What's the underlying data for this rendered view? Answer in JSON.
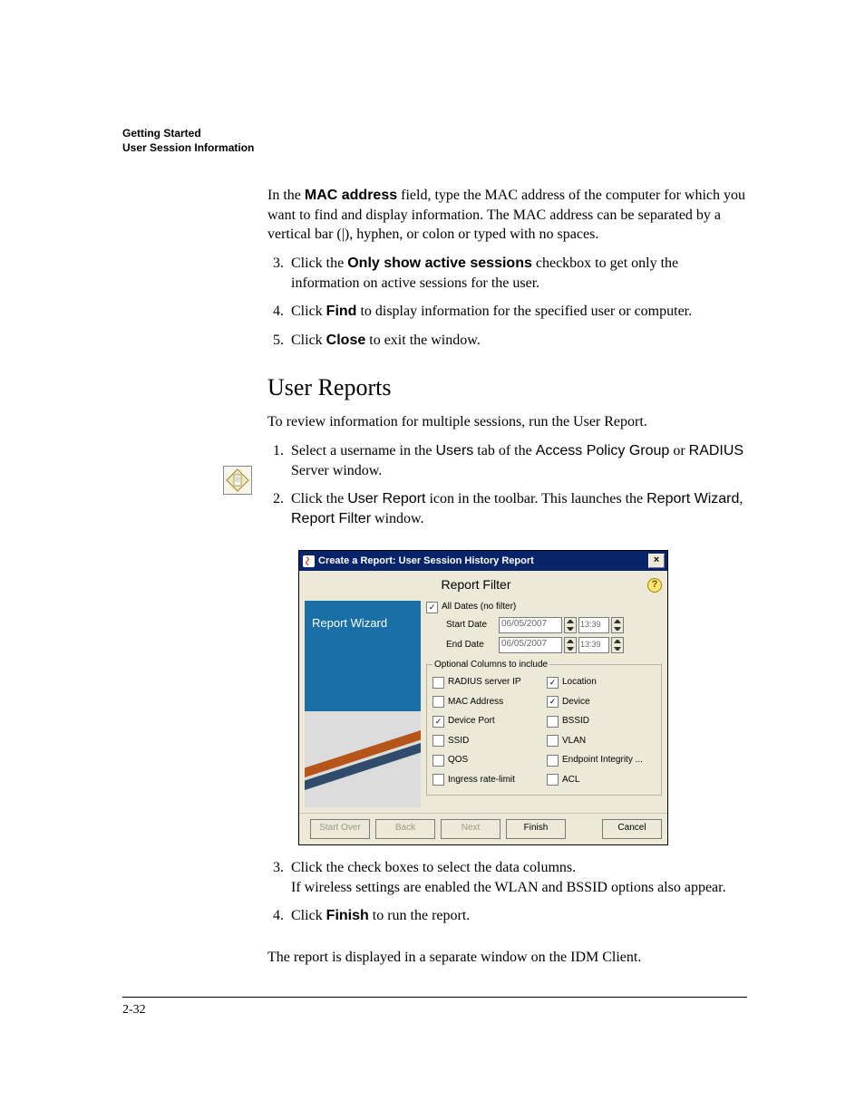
{
  "header": {
    "line1": "Getting Started",
    "line2": "User Session Information"
  },
  "intro_para": {
    "pre": "In the ",
    "bold": "MAC address",
    "post": " field, type the MAC address of the computer for which you want to find and display information. The MAC address can be separated by a vertical bar (|), hyphen, or colon or typed with no spaces."
  },
  "steps_a": {
    "s3": {
      "pre": "Click the ",
      "bold": "Only show active sessions",
      "post": " checkbox to get only the information on active sessions for the user."
    },
    "s4": {
      "pre": "Click ",
      "bold": "Find",
      "post": " to display information for the specified user or computer."
    },
    "s5": {
      "pre": "Click ",
      "bold": "Close",
      "post": " to exit the window."
    }
  },
  "section_title": "User Reports",
  "section_intro": "To review information for multiple sessions, run the User Report.",
  "steps_b": {
    "s1": {
      "t1": "Select a username in the ",
      "u1": "Users",
      "t2": " tab of the ",
      "u2": "Access Policy Group",
      "t3": " or ",
      "u3": "RADIUS",
      "t4": " Server window."
    },
    "s2": {
      "t1": "Click the ",
      "u1": "User Report",
      "t2": " icon in the toolbar. This launches the ",
      "u2": "Report Wizard",
      "t3": ", ",
      "u3": "Report Filter",
      "t4": " window."
    },
    "s3": {
      "line1": "Click the check boxes to select the data columns.",
      "line2": "If wireless settings are enabled the WLAN and BSSID options also appear."
    },
    "s4": {
      "pre": "Click ",
      "bold": "Finish",
      "post": " to run the report."
    }
  },
  "closing": "The report is displayed in a separate window on the IDM Client.",
  "wizard": {
    "title": "Create a Report: User Session History Report",
    "subtitle": "Report Filter",
    "left_title": "Report Wizard",
    "all_dates": "All Dates (no filter)",
    "start_date_label": "Start Date",
    "end_date_label": "End Date",
    "start_date": "06/05/2007",
    "start_time": "13:39",
    "end_date": "06/05/2007",
    "end_time": "13:39",
    "fieldset": "Optional Columns to include",
    "cols": {
      "radius": "RADIUS server IP",
      "location": "Location",
      "mac": "MAC Address",
      "device": "Device",
      "deviceport": "Device Port",
      "bssid": "BSSID",
      "ssid": "SSID",
      "vlan": "VLAN",
      "qos": "QOS",
      "endpoint": "Endpoint Integrity ...",
      "ingress": "Ingress rate-limit",
      "acl": "ACL"
    },
    "buttons": {
      "startover": "Start Over",
      "back": "Back",
      "next": "Next",
      "finish": "Finish",
      "cancel": "Cancel"
    }
  },
  "page_number": "2-32"
}
